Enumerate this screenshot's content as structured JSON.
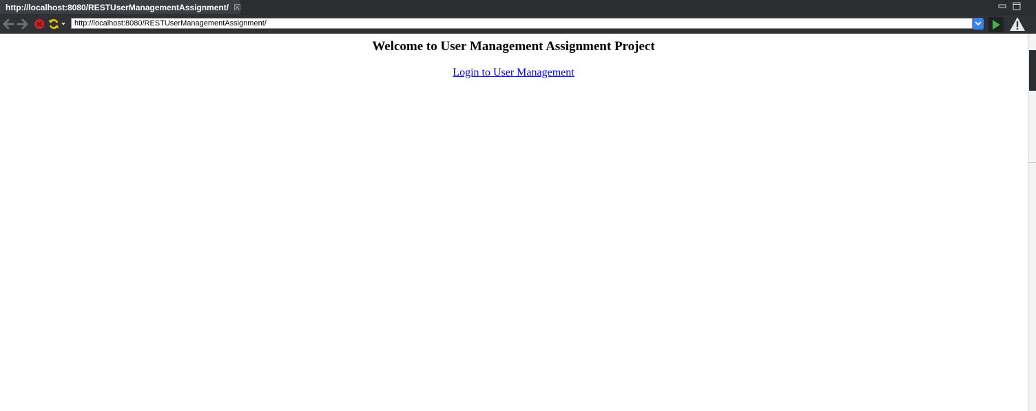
{
  "browser": {
    "tab": {
      "title": "http://localhost:8080/RESTUserManagementAssignment/",
      "icon": "globe-icon",
      "close_icon": "close-icon"
    },
    "toolbar": {
      "address": "http://localhost:8080/RESTUserManagementAssignment/",
      "back_icon": "arrow-left-icon",
      "forward_icon": "arrow-right-icon",
      "stop_icon": "stop-icon",
      "refresh_icon": "refresh-icon",
      "go_icon": "play-icon",
      "warning_icon": "warning-icon",
      "colors": {
        "chrome_bg": "#2b2d30",
        "stop": "#d9262c",
        "refresh": "#f2c200",
        "go": "#3fb63f",
        "address_dropdown": "#3b82f0"
      }
    }
  },
  "page": {
    "heading": "Welcome to User Management Assignment Project",
    "link_label": "Login to User Management",
    "link_color": "#0000ee"
  }
}
